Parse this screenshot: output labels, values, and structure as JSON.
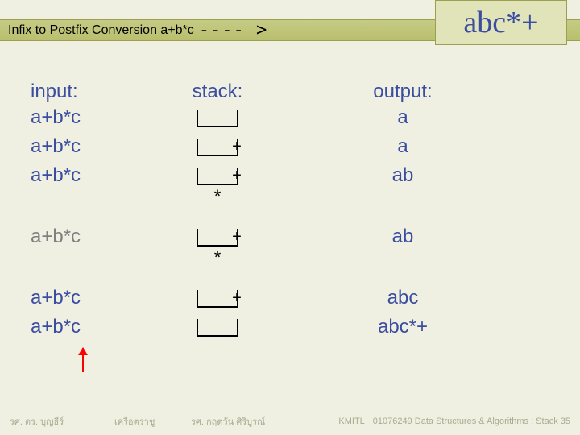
{
  "title": "Infix to Postfix Conversion  a+b*c",
  "title_dashes": "---- >",
  "result": "abc*+",
  "headers": {
    "input": "input:",
    "stack": "stack:",
    "output": "output:"
  },
  "rows": [
    {
      "input": "a+b*c",
      "input_gray": false,
      "stack_in": "",
      "stack_below": "",
      "output": "a"
    },
    {
      "input": "a+b*c",
      "input_gray": false,
      "stack_in": "+",
      "stack_below": "",
      "output": "a"
    },
    {
      "input": "a+b*c",
      "input_gray": false,
      "stack_in": "+",
      "stack_below": "*",
      "output": "ab"
    },
    {
      "input": "a+b*c",
      "input_gray": true,
      "stack_in": "+",
      "stack_below": "*",
      "output": "ab"
    },
    {
      "input": "a+b*c",
      "input_gray": false,
      "stack_in": "+",
      "stack_below": "",
      "output": "abc"
    },
    {
      "input": "a+b*c",
      "input_gray": false,
      "stack_in": "",
      "stack_below": "",
      "output": "abc*+"
    }
  ],
  "footer": {
    "f1": "รศ. ดร. บุญธีร์",
    "f2": "เครือตราชู",
    "f3": "รศ. กฤตวัน   ศิริบูรณ์",
    "f4": "KMITL",
    "f5": "01076249 Data Structures & Algorithms : Stack 35"
  }
}
